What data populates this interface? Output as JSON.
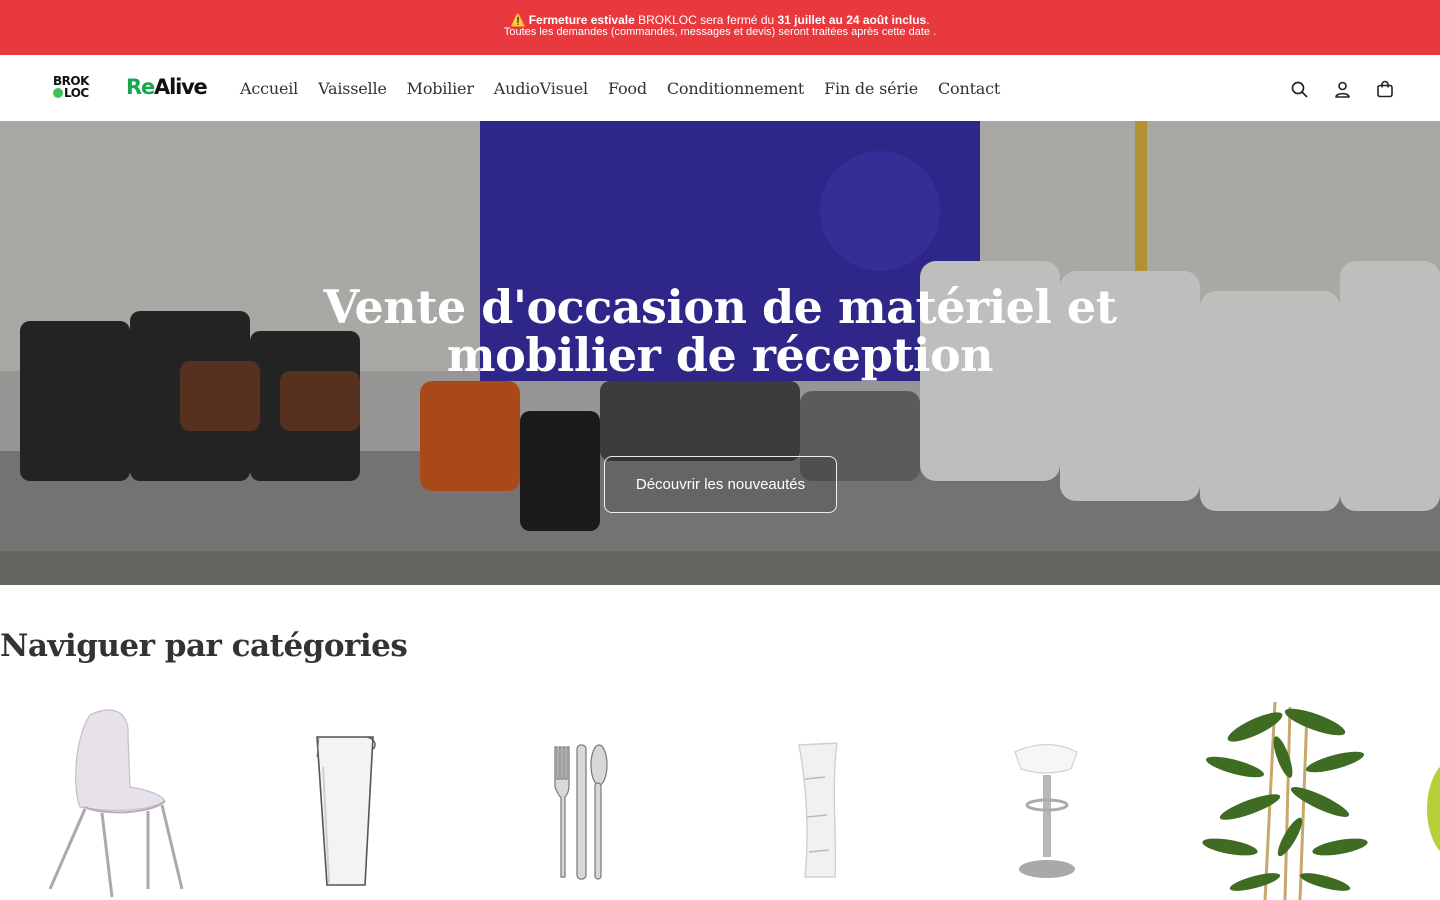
{
  "announcement": {
    "icon": "warning-icon",
    "line1_bold1": "⚠️ Fermeture estivale",
    "line1_text1": " BROKLOC sera fermé du ",
    "line1_bold2": "31 juillet au 24 août inclus",
    "line1_text2": ".",
    "line2": "Toutes les demandes (commandes, messages et devis) seront traitées après cette date ."
  },
  "header": {
    "logo1_line1": "BROK",
    "logo1_line2": "LOC",
    "logo2_re": "Re",
    "logo2_alive": "Alive",
    "nav": [
      "Accueil",
      "Vaisselle",
      "Mobilier",
      "AudioVisuel",
      "Food",
      "Conditionnement",
      "Fin de série",
      "Contact"
    ],
    "icons": [
      "search-icon",
      "account-icon",
      "cart-icon"
    ]
  },
  "hero": {
    "title": "Vente d'occasion de matériel et mobilier de réception",
    "button": "Découvrir les nouveautés"
  },
  "categories": {
    "title": "Naviguer par catégories",
    "items": [
      "chair-image",
      "carafe-image",
      "cutlery-image",
      "display-stand-image",
      "bar-stool-image",
      "bamboo-plant-image",
      "partial-item-image"
    ]
  },
  "colors": {
    "announcement_bg": "#e8393f",
    "brand_green": "#1aa54f",
    "text_dark": "#333333"
  }
}
